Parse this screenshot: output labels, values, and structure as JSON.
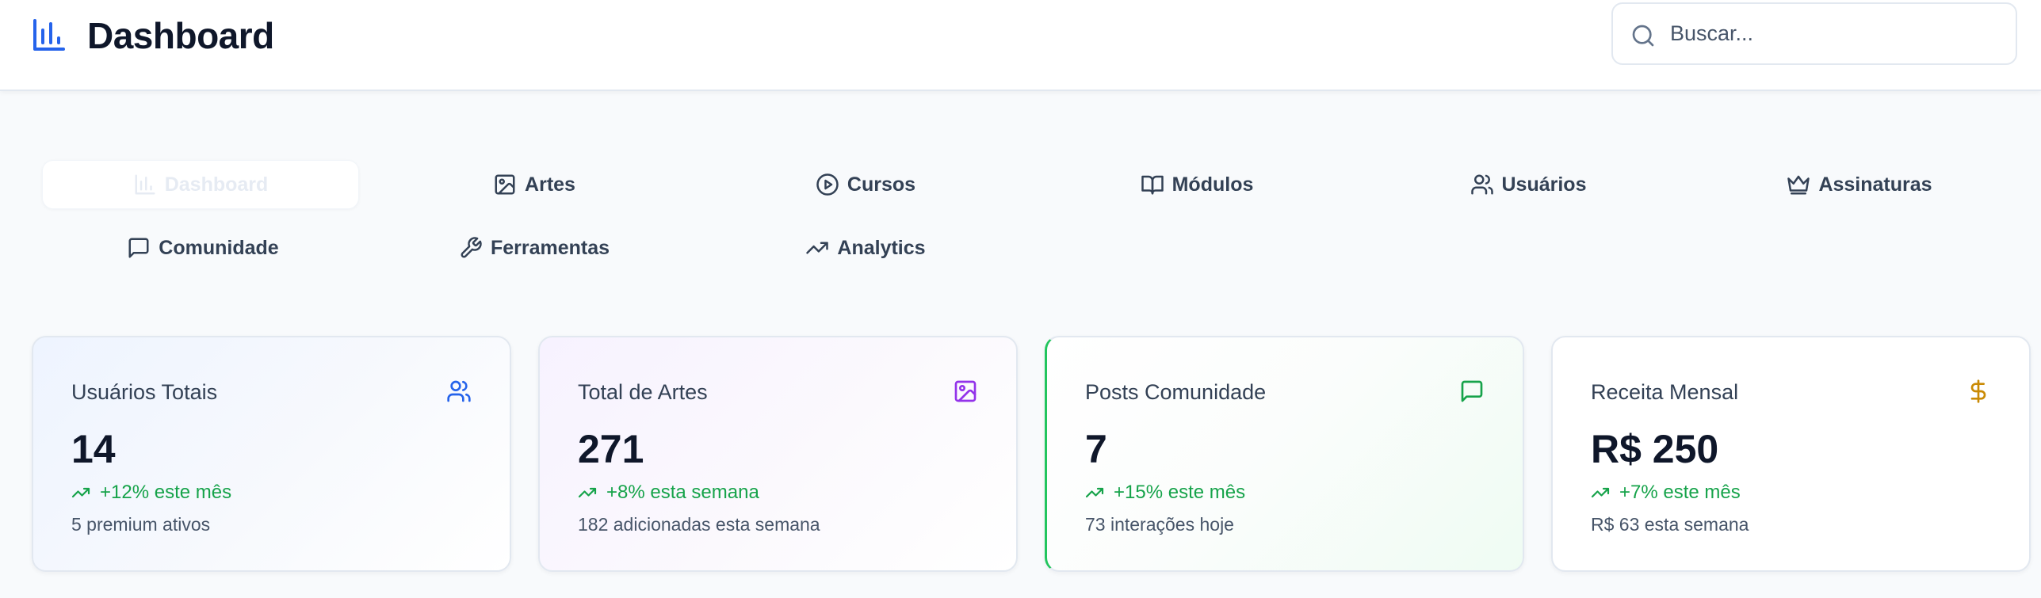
{
  "header": {
    "title": "Dashboard",
    "brand_icon": "bar-chart-icon",
    "search": {
      "placeholder": "Buscar...",
      "value": ""
    }
  },
  "nav": {
    "items": [
      {
        "label": "Dashboard",
        "icon": "bar-chart-icon",
        "active": true
      },
      {
        "label": "Artes",
        "icon": "image-icon"
      },
      {
        "label": "Cursos",
        "icon": "play-circle-icon"
      },
      {
        "label": "Módulos",
        "icon": "book-open-icon"
      },
      {
        "label": "Usuários",
        "icon": "users-icon"
      },
      {
        "label": "Assinaturas",
        "icon": "crown-icon"
      },
      {
        "label": "Comunidade",
        "icon": "message-square-icon"
      },
      {
        "label": "Ferramentas",
        "icon": "wrench-icon"
      },
      {
        "label": "Analytics",
        "icon": "trending-up-icon"
      }
    ]
  },
  "stats": [
    {
      "title": "Usuários Totais",
      "value": "14",
      "trend": "+12% este mês",
      "sub": "5 premium ativos",
      "icon": "users-icon",
      "icon_color": "#2563eb"
    },
    {
      "title": "Total de Artes",
      "value": "271",
      "trend": "+8% esta semana",
      "sub": "182 adicionadas esta semana",
      "icon": "image-icon",
      "icon_color": "#9333ea"
    },
    {
      "title": "Posts Comunidade",
      "value": "7",
      "trend": "+15% este mês",
      "sub": "73 interações hoje",
      "icon": "message-square-icon",
      "icon_color": "#16a34a"
    },
    {
      "title": "Receita Mensal",
      "value": "R$ 250",
      "trend": "+7% este mês",
      "sub": "R$ 63 esta semana",
      "icon": "dollar-icon",
      "icon_color": "#ca8a04"
    }
  ],
  "colors": {
    "accent": "#2563eb",
    "trend_positive": "#16a34a",
    "border": "#e2e8f0",
    "background": "#f8fafc"
  }
}
